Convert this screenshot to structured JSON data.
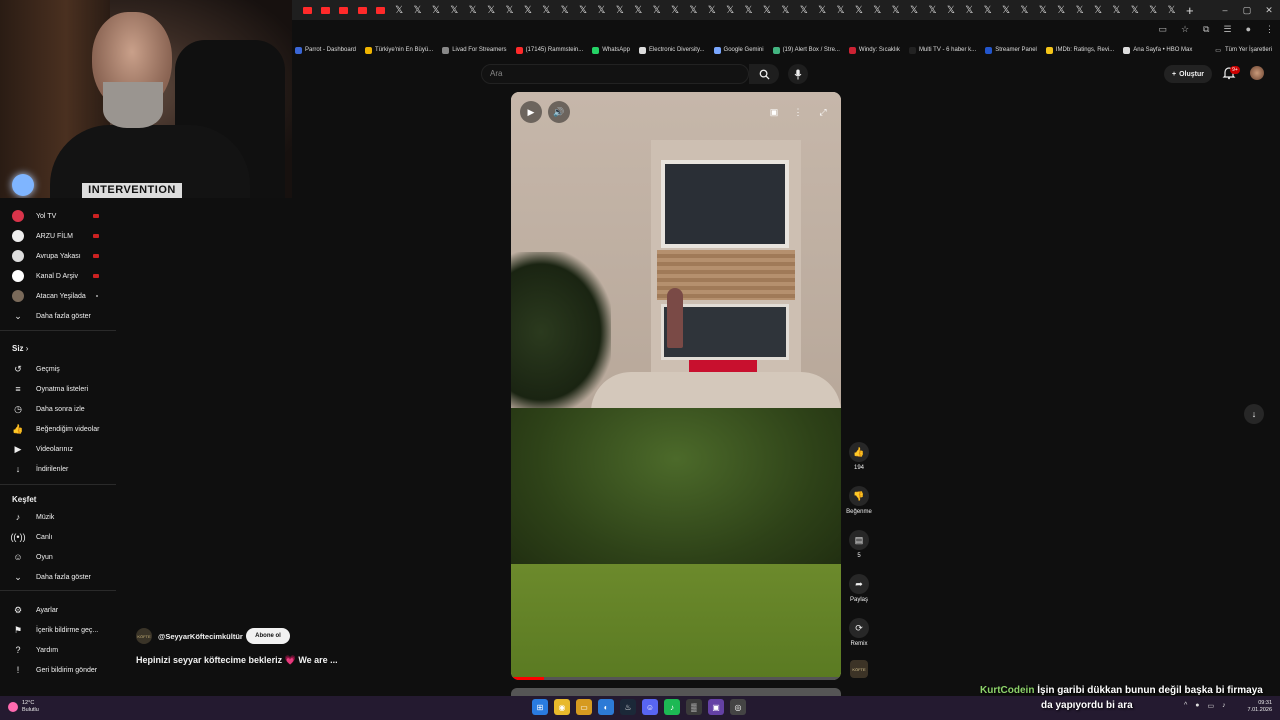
{
  "browser": {
    "tab_count": 48,
    "window_controls": [
      "–",
      "▢",
      "✕"
    ],
    "bookmarks": [
      {
        "label": "Parrot - Dashboard",
        "color": "#3a66d6"
      },
      {
        "label": "Türkiye'nin En Büyü...",
        "color": "#f0b400"
      },
      {
        "label": "Livad For Streamers",
        "color": "#888888"
      },
      {
        "label": "(17145) Rammstein...",
        "color": "#ff2a2a"
      },
      {
        "label": "WhatsApp",
        "color": "#25d366"
      },
      {
        "label": "Electronic Diversity...",
        "color": "#dddddd"
      },
      {
        "label": "Google Gemini",
        "color": "#7aa7ff"
      },
      {
        "label": "(19) Alert Box / Stre...",
        "color": "#43b581"
      },
      {
        "label": "Windy: Sıcaklık",
        "color": "#cc2233"
      },
      {
        "label": "Multi TV - 6 haber k...",
        "color": "#222222"
      },
      {
        "label": "Streamer Panel",
        "color": "#2255cc"
      },
      {
        "label": "IMDb: Ratings, Revi...",
        "color": "#f5c518"
      },
      {
        "label": "Ana Sayfa • HBO Max",
        "color": "#dddddd"
      }
    ],
    "all_bookmarks_label": "Tüm Yer İşaretleri"
  },
  "header": {
    "search_placeholder": "Ara",
    "create_label": "Oluştur",
    "notification_count": "9+"
  },
  "sidebar": {
    "subscriptions": [
      {
        "label": "Yol TV",
        "live": true,
        "color": "#d8344a"
      },
      {
        "label": "ARZU FİLM",
        "live": true,
        "color": "#eeeeee"
      },
      {
        "label": "Avrupa Yakası",
        "live": true,
        "color": "#dddddd"
      },
      {
        "label": "Kanal D Arşiv",
        "live": true,
        "color": "#ffffff"
      },
      {
        "label": "Atacan Yeşilada",
        "live": false,
        "color": "#7a6a5a"
      }
    ],
    "show_more_1": "Daha fazla göster",
    "you_heading": "Siz",
    "you_items": [
      {
        "label": "Geçmiş",
        "icon": "history-icon"
      },
      {
        "label": "Oynatma listeleri",
        "icon": "playlist-icon"
      },
      {
        "label": "Daha sonra izle",
        "icon": "clock-icon"
      },
      {
        "label": "Beğendiğim videolar",
        "icon": "thumb-up-icon"
      },
      {
        "label": "Videolarınız",
        "icon": "video-icon"
      },
      {
        "label": "İndirilenler",
        "icon": "download-icon"
      }
    ],
    "explore_heading": "Keşfet",
    "explore_items": [
      {
        "label": "Müzik",
        "icon": "music-icon"
      },
      {
        "label": "Canlı",
        "icon": "live-icon"
      },
      {
        "label": "Oyun",
        "icon": "gamepad-icon"
      }
    ],
    "show_more_2": "Daha fazla göster",
    "bottom_items": [
      {
        "label": "Ayarlar",
        "icon": "gear-icon"
      },
      {
        "label": "İçerik bildirme geç...",
        "icon": "flag-icon"
      },
      {
        "label": "Yardım",
        "icon": "help-icon"
      },
      {
        "label": "Geri bildirim gönder",
        "icon": "feedback-icon"
      }
    ]
  },
  "webcam": {
    "shirt_text": "INTERVENTION"
  },
  "short": {
    "progress": 0.1,
    "channel": "@SeyyarKöftecimkültür",
    "subscribe_label": "Abone ol",
    "description": "Hepinizi seyyar köftecime bekleriz",
    "description_tail": "We are ...",
    "heart": "💗"
  },
  "actions": {
    "like_count": "194",
    "dislike_label": "Beğenme",
    "comment_count": "5",
    "share_label": "Paylaş",
    "remix_label": "Remix"
  },
  "chat": {
    "user": "KurtCodein",
    "line1": "İşin garibi dükkan bunun değil başka bi firmaya",
    "line2": "da yapıyordu bi ara"
  },
  "taskbar": {
    "temp": "12°C",
    "weather": "Bulutlu",
    "time": "09:31",
    "date": "7.01.2026"
  }
}
